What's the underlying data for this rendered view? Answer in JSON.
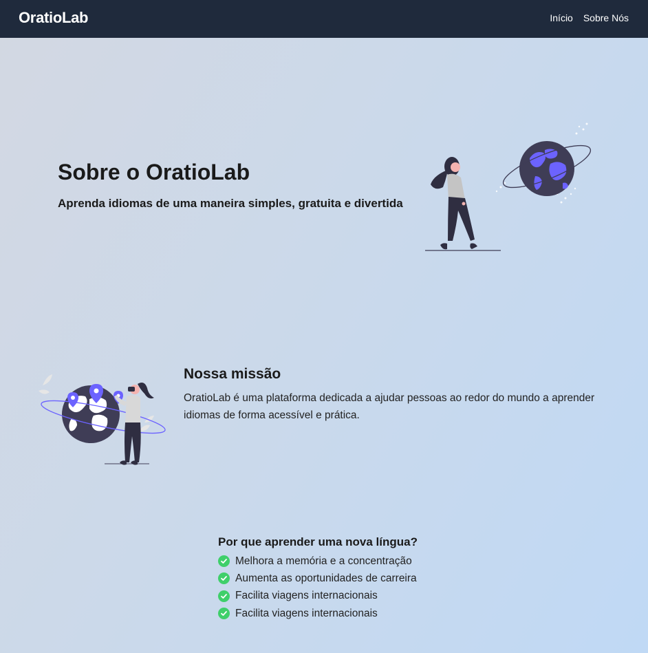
{
  "nav": {
    "brand": "OratioLab",
    "links": [
      "Início",
      "Sobre Nós"
    ]
  },
  "hero": {
    "title": "Sobre o OratioLab",
    "subtitle": "Aprenda idiomas de uma maneira simples, gratuita e divertida",
    "illustration": "woman-walking-globe-illustration"
  },
  "mission": {
    "title": "Nossa missão",
    "text": "OratioLab é uma plataforma dedicada a ajudar pessoas ao redor do mundo a aprender idiomas de forma acessível e prática.",
    "illustration": "woman-vr-globe-pins-illustration"
  },
  "why": {
    "title": "Por que aprender uma nova língua?",
    "items": [
      "Melhora a memória e a concentração",
      "Aumenta as oportunidades de carreira",
      "Facilita viagens internacionais",
      "Facilita viagens internacionais"
    ],
    "icon": "check-circle-icon"
  },
  "colors": {
    "navbar": "#1f2a3c",
    "accent": "#6c63ff",
    "check": "#3fcf6a",
    "text": "#1a1a1a"
  }
}
